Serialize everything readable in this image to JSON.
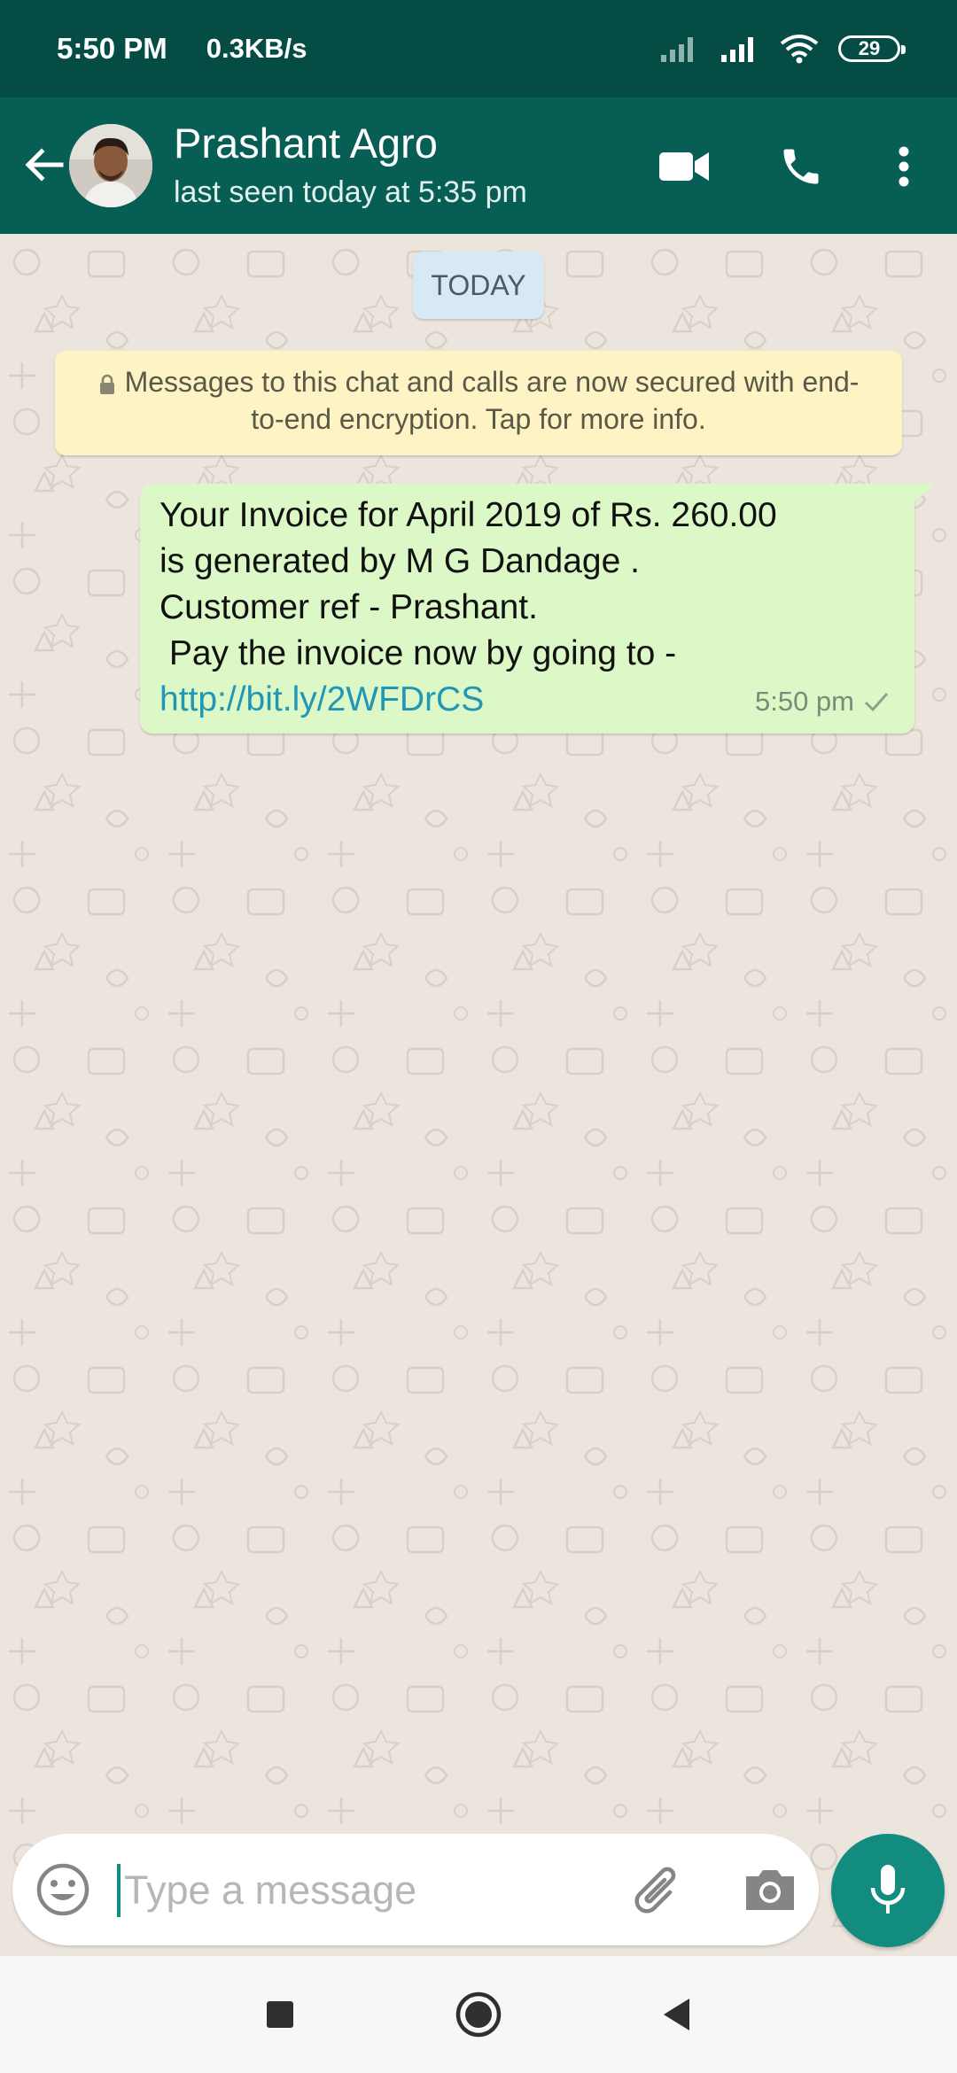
{
  "status_bar": {
    "time": "5:50 PM",
    "speed": "0.3KB/s",
    "battery": "29",
    "icons": [
      "signal-weak-icon",
      "signal-icon",
      "wifi-icon",
      "battery-icon"
    ]
  },
  "header": {
    "contact_name": "Prashant Agro",
    "last_seen": "last seen today at 5:35 pm",
    "icons": [
      "back-arrow-icon",
      "avatar",
      "video-call-icon",
      "phone-call-icon",
      "more-options-icon"
    ]
  },
  "chat": {
    "date_chip": "TODAY",
    "encryption_notice": "Messages to this chat and calls are now secured with end-to-end encryption. Tap for more info.",
    "messages": [
      {
        "direction": "outgoing",
        "lines": [
          "Your Invoice for April 2019 of Rs. 260.00",
          "is generated by M G Dandage .",
          "Customer ref - Prashant.",
          " Pay the invoice now by going to -"
        ],
        "link": "http://bit.ly/2WFDrCS",
        "time": "5:50 pm",
        "status": "sent"
      }
    ]
  },
  "composer": {
    "placeholder": "Type a message",
    "value": "",
    "icons": [
      "emoji-icon",
      "attach-icon",
      "camera-icon",
      "mic-icon"
    ]
  },
  "nav": {
    "icons": [
      "recents-square-icon",
      "home-circle-icon",
      "back-triangle-icon"
    ]
  },
  "colors": {
    "status_bar": "#054d44",
    "app_bar": "#075e54",
    "accent": "#128c7e",
    "outgoing_bubble": "#dcf8c6",
    "encryption_banner": "#fdf3c4",
    "date_chip": "#d7e9f4",
    "link": "#2196b5",
    "chat_background": "#ece5dd"
  }
}
